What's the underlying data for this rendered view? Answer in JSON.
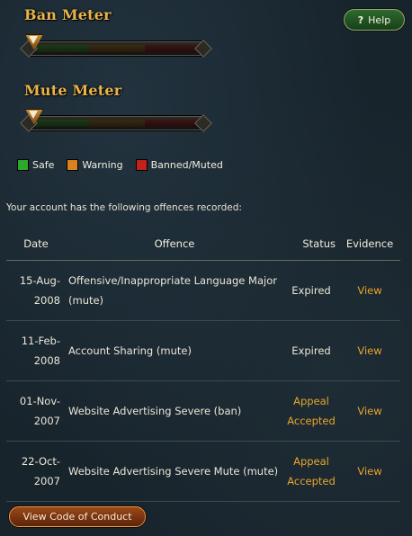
{
  "ban_meter": {
    "title": "Ban Meter",
    "level": 0
  },
  "mute_meter": {
    "title": "Mute Meter",
    "level": 0
  },
  "help": {
    "label": "Help",
    "icon": "?"
  },
  "legend": [
    {
      "label": "Safe",
      "color": "#2ea82a"
    },
    {
      "label": "Warning",
      "color": "#d9821e"
    },
    {
      "label": "Banned/Muted",
      "color": "#c4201c"
    }
  ],
  "intro_text": "Your account has the following offences recorded:",
  "table": {
    "headers": {
      "date": "Date",
      "offence": "Offence",
      "status": "Status",
      "evidence": "Evidence"
    },
    "rows": [
      {
        "date_day": "15-Aug-",
        "date_year": "2008",
        "offence_line1": "Offensive/Inappropriate Language Major",
        "offence_line2": "(mute)",
        "status_line1": "Expired",
        "status_line2": "",
        "evidence": "View"
      },
      {
        "date_day": "11-Feb-",
        "date_year": "2008",
        "offence_line1": "Account Sharing (mute)",
        "offence_line2": "",
        "status_line1": "Expired",
        "status_line2": "",
        "evidence": "View"
      },
      {
        "date_day": "01-Nov-",
        "date_year": "2007",
        "offence_line1": "Website Advertising Severe (ban)",
        "offence_line2": "",
        "status_line1": "Appeal",
        "status_line2": "Accepted",
        "evidence": "View"
      },
      {
        "date_day": "22-Oct-",
        "date_year": "2007",
        "offence_line1": "Website Advertising Severe Mute (mute)",
        "offence_line2": "",
        "status_line1": "Appeal",
        "status_line2": "Accepted",
        "evidence": "View"
      }
    ]
  },
  "code_of_conduct_button": "View Code of Conduct"
}
